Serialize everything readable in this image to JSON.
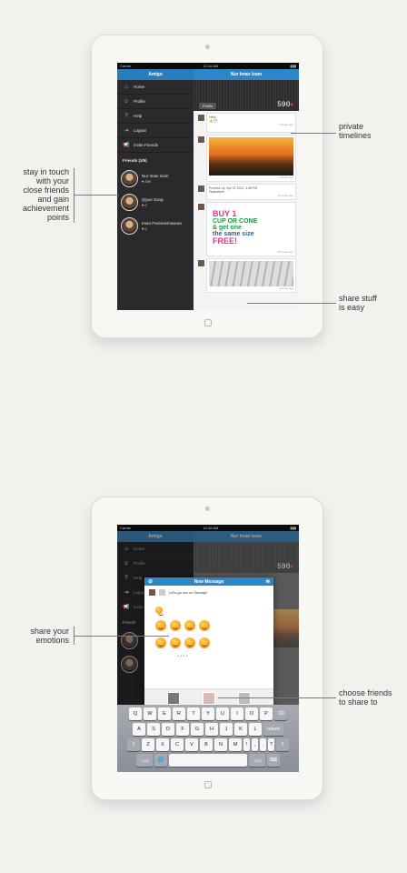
{
  "ipad1": {
    "status": {
      "carrier": "Carrier",
      "time": "12:16 AM"
    },
    "left_title": "Amigo",
    "right_title": "Nur Iman Izam",
    "menu": [
      {
        "label": "Home",
        "icon": "home-icon"
      },
      {
        "label": "Profile",
        "icon": "user-icon"
      },
      {
        "label": "Help",
        "icon": "help-icon"
      },
      {
        "label": "Logout",
        "icon": "logout-icon"
      },
      {
        "label": "Invite Friends",
        "icon": "megaphone-icon"
      }
    ],
    "friends_header": "Friends (3/5)",
    "friends": [
      {
        "name": "Nur Iman Izam",
        "points": "590"
      },
      {
        "name": "Qiyue Song",
        "points": "0"
      },
      {
        "name": "Irsan Parameshwaran",
        "points": "0"
      }
    ],
    "profile_tab": "Profile",
    "score": "590",
    "post1": {
      "text": "Hello",
      "time": "2 hours ago"
    },
    "post2": {
      "time": "2 hours ago"
    },
    "post3": {
      "meta": "Promise by: Apr 21 2013, 3:28 PM",
      "text": "Testosterie",
      "time": "12 hours ago"
    },
    "ad": {
      "line1": "BUY 1",
      "line2": "CUP OR CONE",
      "line3": "& get one",
      "line4": "the same size",
      "line5": "FREE!",
      "time": "26 hours ago"
    },
    "post5": {
      "time": "2 hours ago"
    }
  },
  "ipad2": {
    "status": {
      "carrier": "Carrier",
      "time": "12:16 AM"
    },
    "left_title": "Amigo",
    "right_title": "Nur Iman Izam",
    "score": "590",
    "menu": [
      {
        "label": "Home"
      },
      {
        "label": "Profile"
      },
      {
        "label": "Help"
      },
      {
        "label": "Logout"
      },
      {
        "label": "Invite"
      }
    ],
    "friends_header": "Friend",
    "modal": {
      "title": "New Message",
      "message": "Let's go out on Sunday!"
    },
    "keyboard": [
      [
        "Q",
        "W",
        "E",
        "R",
        "T",
        "Y",
        "U",
        "I",
        "O",
        "P",
        "⌫"
      ],
      [
        "A",
        "S",
        "D",
        "F",
        "G",
        "H",
        "J",
        "K",
        "L",
        "return"
      ],
      [
        "⇧",
        "Z",
        "X",
        "C",
        "V",
        "B",
        "N",
        "M",
        "!",
        ",",
        ".",
        "?",
        "⇧"
      ],
      [
        ".?123",
        "🌐",
        "",
        ".?123",
        "⌨"
      ]
    ]
  },
  "callouts": {
    "private_timelines": "private\ntimelines",
    "stay_in_touch": "stay in touch\nwith your\nclose friends\nand gain\nachievement\npoints",
    "share_stuff": "share stuff\nis easy",
    "share_emotions": "share your\nemotions",
    "choose_friends": "choose friends\nto share to"
  },
  "colors": {
    "accent": "#2d86c7",
    "background": "#f1f1ee",
    "sidebar": "#2a2a2c"
  }
}
